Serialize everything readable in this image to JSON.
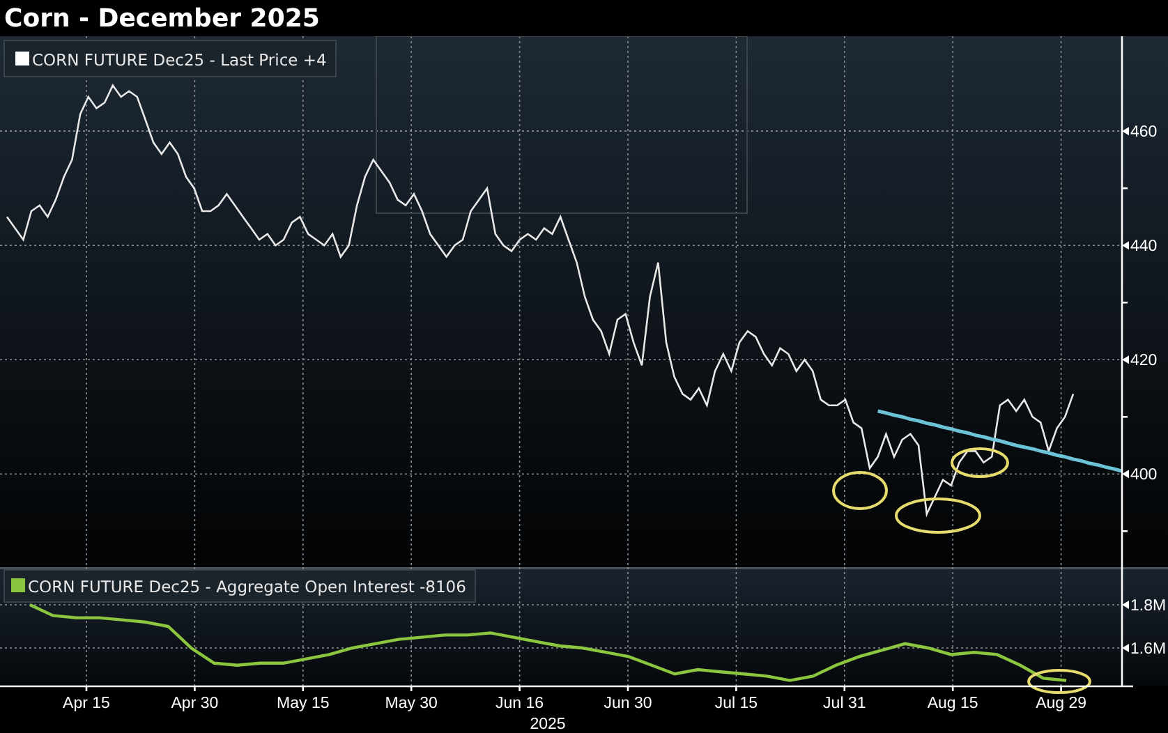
{
  "title": "Corn - December 2025",
  "price_panel": {
    "legend": {
      "label": "CORN FUTURE Dec25 - Last Price +4",
      "color": "#ffffff"
    },
    "chart_data": {
      "type": "line",
      "grid": true,
      "ylim": [
        383.7,
        476.6
      ],
      "yticks": [
        400,
        420,
        440,
        460
      ],
      "series": [
        {
          "color": "#e8e8e8",
          "values": [
            445,
            443,
            441,
            446,
            447,
            445,
            448,
            452,
            455,
            463,
            466,
            464,
            465,
            468,
            466,
            467,
            466,
            462,
            458,
            456,
            458,
            456,
            452,
            450,
            446,
            446,
            447,
            449,
            447,
            445,
            443,
            441,
            442,
            440,
            441,
            444,
            445,
            442,
            441,
            440,
            442,
            438,
            440,
            447,
            452,
            455,
            453,
            451,
            448,
            447,
            449,
            446,
            442,
            440,
            438,
            440,
            441,
            446,
            448,
            450,
            442,
            440,
            439,
            441,
            442,
            441,
            443,
            442,
            445,
            441,
            437,
            431,
            427,
            425,
            421,
            427,
            428,
            423,
            419,
            431,
            437,
            423,
            417,
            414,
            413,
            415,
            412,
            418,
            421,
            418,
            423,
            425,
            424,
            421,
            419,
            422,
            421,
            418,
            420,
            418,
            413,
            412,
            412,
            413,
            409,
            408,
            401,
            403,
            407,
            403,
            406,
            407,
            405,
            393,
            396,
            399,
            398,
            402,
            404,
            404,
            402,
            403,
            412,
            413,
            411,
            413,
            410,
            409,
            404,
            408,
            410,
            414,
            null,
            null,
            null,
            null,
            null,
            null
          ]
        },
        {
          "color": "#6cc3d5",
          "values": [
            null,
            null,
            null,
            null,
            null,
            null,
            null,
            null,
            null,
            null,
            null,
            null,
            null,
            null,
            null,
            null,
            null,
            null,
            null,
            null,
            null,
            null,
            null,
            null,
            null,
            null,
            null,
            null,
            null,
            null,
            null,
            null,
            null,
            null,
            null,
            null,
            null,
            null,
            null,
            null,
            null,
            null,
            null,
            null,
            null,
            null,
            null,
            null,
            null,
            null,
            null,
            null,
            null,
            null,
            null,
            null,
            null,
            null,
            null,
            null,
            null,
            null,
            null,
            null,
            null,
            null,
            null,
            null,
            null,
            null,
            null,
            null,
            null,
            null,
            null,
            null,
            null,
            null,
            null,
            null,
            null,
            null,
            null,
            null,
            null,
            null,
            null,
            null,
            null,
            null,
            null,
            null,
            null,
            null,
            null,
            null,
            null,
            null,
            null,
            null,
            null,
            null,
            null,
            null,
            null,
            null,
            null,
            411,
            410.7,
            410.3,
            410,
            409.6,
            409.3,
            408.9,
            408.6,
            408.2,
            407.9,
            407.5,
            407.2,
            406.8,
            406.5,
            406.1,
            405.8,
            405.4,
            405,
            404.7,
            404.4,
            404,
            403.7,
            403.3,
            403,
            402.6,
            402.3,
            401.9,
            401.6,
            401.2,
            400.9,
            400.5
          ]
        }
      ]
    }
  },
  "open_interest_panel": {
    "legend": {
      "label": "CORN FUTURE Dec25 - Aggregate Open Interest -8106",
      "color": "#8cc63f"
    },
    "chart_data": {
      "type": "line",
      "grid": true,
      "ylim": [
        1.426,
        1.974
      ],
      "yticks": [
        {
          "value": 1.6,
          "label": "1.6M"
        },
        {
          "value": 1.8,
          "label": "1.8M"
        }
      ],
      "series": [
        {
          "color": "#8cc63f",
          "values": [
            null,
            1.8,
            1.75,
            1.74,
            1.74,
            1.73,
            1.72,
            1.7,
            1.6,
            1.53,
            1.52,
            1.53,
            1.53,
            1.55,
            1.57,
            1.6,
            1.62,
            1.64,
            1.65,
            1.66,
            1.66,
            1.67,
            1.65,
            1.63,
            1.61,
            1.6,
            1.58,
            1.56,
            1.52,
            1.48,
            1.5,
            1.49,
            1.48,
            1.47,
            1.45,
            1.47,
            1.52,
            1.56,
            1.59,
            1.62,
            1.6,
            1.57,
            1.58,
            1.57,
            1.52,
            1.46,
            1.45
          ]
        }
      ]
    }
  },
  "x_axis": {
    "labels": [
      "Apr 15",
      "Apr 30",
      "May 15",
      "May 30",
      "Jun 16",
      "Jun 30",
      "Jul 15",
      "Jul 31",
      "Aug 15",
      "Aug 29"
    ],
    "year": "2025"
  }
}
